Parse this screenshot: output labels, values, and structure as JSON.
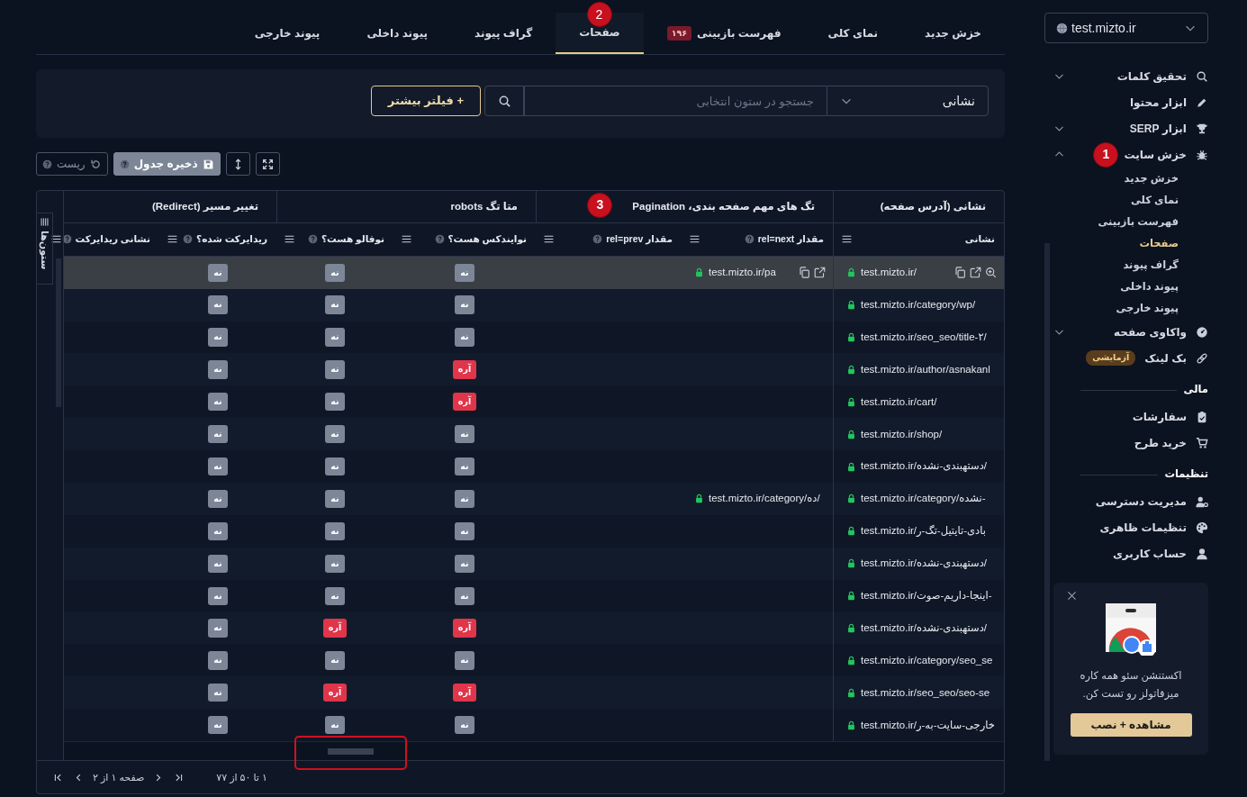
{
  "site_selector": {
    "value": "test.mizto.ir"
  },
  "sidebar": {
    "items": [
      {
        "kind": "item",
        "label": "تحقیق کلمات",
        "expanded": false
      },
      {
        "kind": "item",
        "label": "ابزار محتوا"
      },
      {
        "kind": "item",
        "label": "ابزار SERP",
        "expanded": false
      },
      {
        "kind": "item",
        "label": "خزش سایت",
        "expanded": true,
        "children": [
          {
            "label": "خزش جدید",
            "selected": false
          },
          {
            "label": "نمای کلی",
            "selected": false
          },
          {
            "label": "فهرست بازبینی",
            "selected": false
          },
          {
            "label": "صفحات",
            "selected": true
          },
          {
            "label": "گراف پیوند",
            "selected": false
          },
          {
            "label": "پیوند داخلی",
            "selected": false
          },
          {
            "label": "پیوند خارجی",
            "selected": false
          }
        ]
      },
      {
        "kind": "item",
        "label": "واکاوی صفحه",
        "expanded": false
      },
      {
        "kind": "item",
        "label": "بک لینک",
        "badge": "آزمایشی"
      },
      {
        "kind": "section",
        "label": "مالی"
      },
      {
        "kind": "item",
        "label": "سفارشات"
      },
      {
        "kind": "item",
        "label": "خرید طرح"
      },
      {
        "kind": "section",
        "label": "تنظیمات"
      },
      {
        "kind": "item",
        "label": "مدیریت دسترسی"
      },
      {
        "kind": "item",
        "label": "تنظیمات ظاهری"
      },
      {
        "kind": "item",
        "label": "حساب کاربری"
      }
    ]
  },
  "promo": {
    "text": "اکستنشن سئو همه کاره میزفاتولز رو تست کن.",
    "button": "مشاهده + نصب"
  },
  "tabs": [
    {
      "label": "خزش جدید",
      "selected": false
    },
    {
      "label": "نمای کلی",
      "selected": false
    },
    {
      "label": "فهرست بازبینی",
      "badge": "۱۹۶",
      "selected": false
    },
    {
      "label": "صفحات",
      "selected": true
    },
    {
      "label": "گراف پیوند",
      "selected": false
    },
    {
      "label": "پیوند داخلی",
      "selected": false
    },
    {
      "label": "پیوند خارجی",
      "selected": false
    }
  ],
  "filter": {
    "column": "نشانی",
    "placeholder": "جستجو در ستون انتخابی",
    "more_button": "+ فیلتر بیشتر"
  },
  "toolbar": {
    "save_button": "ذخیره جدول",
    "reset_button": "ریست"
  },
  "table": {
    "columns_toggle": "ستون‌ها",
    "column_groups": [
      {
        "label": "نشانی (آدرس صفحه)"
      },
      {
        "label": "تگ های مهم صفحه بندی، Pagination"
      },
      {
        "label": "متا تگ robots"
      },
      {
        "label": "تغییر مسیر (Redirect)"
      }
    ],
    "columns": [
      {
        "label": "نشانی",
        "help": false
      },
      {
        "label": "مقدار rel=next",
        "help": true
      },
      {
        "label": "مقدار rel=prev",
        "help": true
      },
      {
        "label": "نوایندکس هست؟",
        "help": true
      },
      {
        "label": "نوفالو هست؟",
        "help": true
      },
      {
        "label": "ریدایرکت شده؟",
        "help": true
      },
      {
        "label": "نشانی ریدایرکت",
        "help": true
      }
    ],
    "rows": [
      {
        "selected": true,
        "url": "test.mizto.ir/",
        "rel_next": "test.mizto.ir/pa",
        "noindex": {
          "text": "نه",
          "on": false
        },
        "nofollow": {
          "text": "نه",
          "on": false
        },
        "redirected": {
          "text": "نه",
          "on": false
        }
      },
      {
        "selected": false,
        "url": "test.mizto.ir/category/wp/",
        "noindex": {
          "text": "نه",
          "on": false
        },
        "nofollow": {
          "text": "نه",
          "on": false
        },
        "redirected": {
          "text": "نه",
          "on": false
        }
      },
      {
        "selected": false,
        "url": "test.mizto.ir/seo_seo/title-۲/",
        "noindex": {
          "text": "نه",
          "on": false
        },
        "nofollow": {
          "text": "نه",
          "on": false
        },
        "redirected": {
          "text": "نه",
          "on": false
        }
      },
      {
        "selected": false,
        "url": "test.mizto.ir/author/asnakanl",
        "noindex": {
          "text": "آره",
          "on": true
        },
        "nofollow": {
          "text": "نه",
          "on": false
        },
        "redirected": {
          "text": "نه",
          "on": false
        }
      },
      {
        "selected": false,
        "url": "test.mizto.ir/cart/",
        "noindex": {
          "text": "آره",
          "on": true
        },
        "nofollow": {
          "text": "نه",
          "on": false
        },
        "redirected": {
          "text": "نه",
          "on": false
        }
      },
      {
        "selected": false,
        "url": "test.mizto.ir/shop/",
        "noindex": {
          "text": "نه",
          "on": false
        },
        "nofollow": {
          "text": "نه",
          "on": false
        },
        "redirected": {
          "text": "نه",
          "on": false
        }
      },
      {
        "selected": false,
        "url": "test.mizto.ir/دستهبندی-نشده/",
        "noindex": {
          "text": "نه",
          "on": false
        },
        "nofollow": {
          "text": "نه",
          "on": false
        },
        "redirected": {
          "text": "نه",
          "on": false
        }
      },
      {
        "selected": false,
        "url": "test.mizto.ir/category/نشده-",
        "rel_next": "test.mizto.ir/category/ده/",
        "noindex": {
          "text": "نه",
          "on": false
        },
        "nofollow": {
          "text": "نه",
          "on": false
        },
        "redirected": {
          "text": "نه",
          "on": false
        }
      },
      {
        "selected": false,
        "url": "test.mizto.ir/بادی-تایتیل-تگ-ر",
        "noindex": {
          "text": "نه",
          "on": false
        },
        "nofollow": {
          "text": "نه",
          "on": false
        },
        "redirected": {
          "text": "نه",
          "on": false
        }
      },
      {
        "selected": false,
        "url": "test.mizto.ir/دستهبندی-نشده/",
        "noindex": {
          "text": "نه",
          "on": false
        },
        "nofollow": {
          "text": "نه",
          "on": false
        },
        "redirected": {
          "text": "نه",
          "on": false
        }
      },
      {
        "selected": false,
        "url": "test.mizto.ir/اینجا-داریم-صوت-",
        "noindex": {
          "text": "نه",
          "on": false
        },
        "nofollow": {
          "text": "نه",
          "on": false
        },
        "redirected": {
          "text": "نه",
          "on": false
        }
      },
      {
        "selected": false,
        "url": "test.mizto.ir/دستهبندی-نشده/",
        "noindex": {
          "text": "آره",
          "on": true
        },
        "nofollow": {
          "text": "آره",
          "on": true
        },
        "redirected": {
          "text": "نه",
          "on": false
        }
      },
      {
        "selected": false,
        "url": "test.mizto.ir/category/seo_se",
        "noindex": {
          "text": "نه",
          "on": false
        },
        "nofollow": {
          "text": "نه",
          "on": false
        },
        "redirected": {
          "text": "نه",
          "on": false
        }
      },
      {
        "selected": false,
        "url": "test.mizto.ir/seo_seo/seo-se",
        "noindex": {
          "text": "آره",
          "on": true
        },
        "nofollow": {
          "text": "آره",
          "on": true
        },
        "redirected": {
          "text": "نه",
          "on": false
        }
      },
      {
        "selected": false,
        "url": "test.mizto.ir/خارجی-سایت-به-ر",
        "noindex": {
          "text": "نه",
          "on": false
        },
        "nofollow": {
          "text": "نه",
          "on": false
        },
        "redirected": {
          "text": "نه",
          "on": false
        }
      }
    ]
  },
  "pagination": {
    "range": "۱ تا ۵۰ از ۷۷",
    "page": "صفحه ۱ از ۲"
  },
  "annotations": [
    {
      "label": "1"
    },
    {
      "label": "2"
    },
    {
      "label": "3"
    }
  ]
}
